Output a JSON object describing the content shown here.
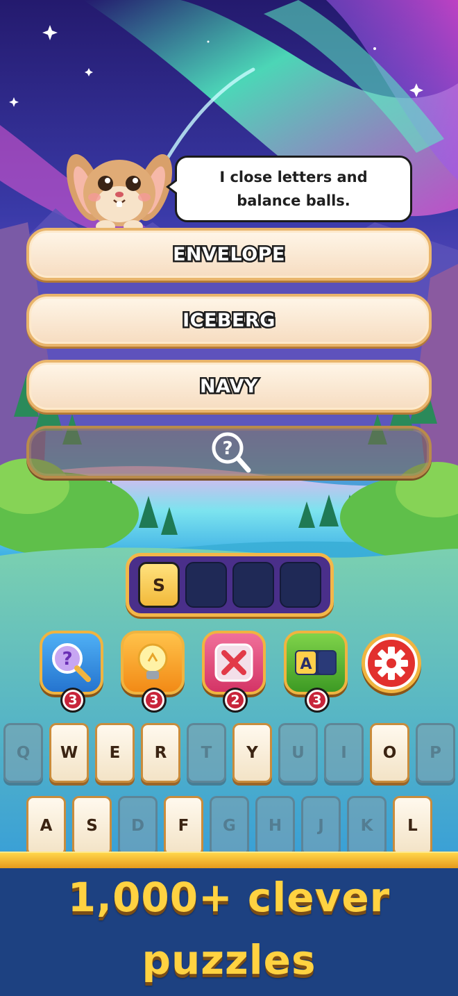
{
  "mascot": {
    "icon": "bunny-mascot-icon",
    "speech": "I close letters and balance balls."
  },
  "answers": [
    {
      "text": "ENVELOPE",
      "state": "revealed"
    },
    {
      "text": "ICEBERG",
      "state": "revealed"
    },
    {
      "text": "NAVY",
      "state": "revealed"
    },
    {
      "text": "",
      "state": "hidden",
      "icon": "magnifier-question-icon"
    }
  ],
  "slots": {
    "letters": [
      "S",
      "",
      "",
      ""
    ]
  },
  "powerups": [
    {
      "name": "reveal-hint",
      "icon": "magnifier-question-icon",
      "count": "3",
      "color": "#2f8fe0"
    },
    {
      "name": "lightbulb-hint",
      "icon": "lightbulb-icon",
      "count": "3",
      "color": "#f59b1f"
    },
    {
      "name": "remove-letters",
      "icon": "x-mark-icon",
      "count": "2",
      "color": "#e4456b"
    },
    {
      "name": "letter-reveal",
      "icon": "letter-a-icon",
      "count": "3",
      "color": "#4fae2c"
    }
  ],
  "settings": {
    "icon": "gear-icon"
  },
  "keyboard": {
    "row1": [
      {
        "letter": "Q",
        "used": true
      },
      {
        "letter": "W",
        "used": false
      },
      {
        "letter": "E",
        "used": false
      },
      {
        "letter": "R",
        "used": false
      },
      {
        "letter": "T",
        "used": true
      },
      {
        "letter": "Y",
        "used": false
      },
      {
        "letter": "U",
        "used": true
      },
      {
        "letter": "I",
        "used": true
      },
      {
        "letter": "O",
        "used": false
      },
      {
        "letter": "P",
        "used": true
      }
    ],
    "row2": [
      {
        "letter": "A",
        "used": false
      },
      {
        "letter": "S",
        "used": false
      },
      {
        "letter": "D",
        "used": true
      },
      {
        "letter": "F",
        "used": false
      },
      {
        "letter": "G",
        "used": true
      },
      {
        "letter": "H",
        "used": true
      },
      {
        "letter": "J",
        "used": true
      },
      {
        "letter": "K",
        "used": true
      },
      {
        "letter": "L",
        "used": false
      }
    ]
  },
  "promo": {
    "line1": "1,000+ clever",
    "line2": "puzzles"
  },
  "colors": {
    "banner": "#1d4181",
    "promo_text": "#ffd241",
    "accent_gold": "#f0b440"
  }
}
